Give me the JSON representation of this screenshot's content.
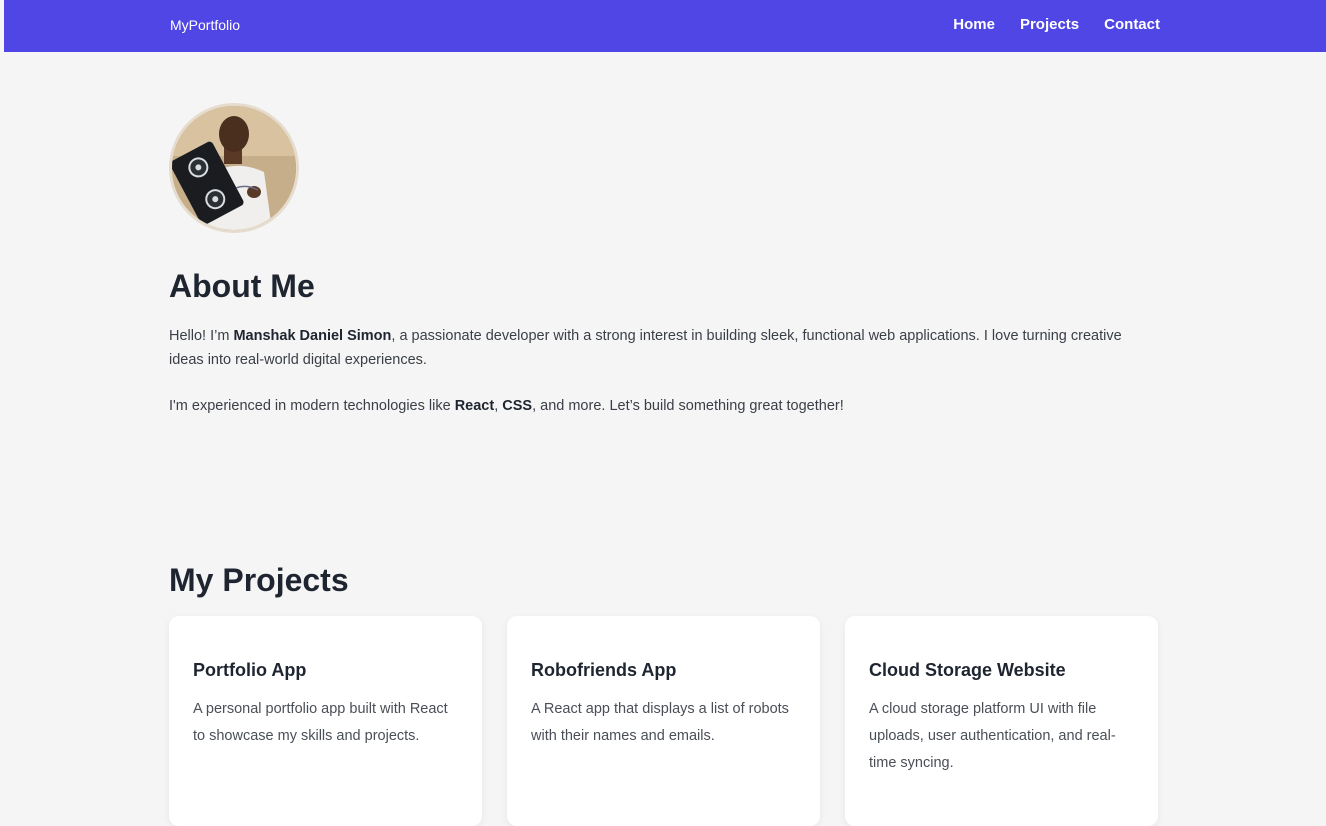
{
  "navbar": {
    "brand": "MyPortfolio",
    "links": [
      {
        "label": "Home"
      },
      {
        "label": "Projects"
      },
      {
        "label": "Contact"
      }
    ]
  },
  "about": {
    "title": "About Me",
    "p1_pre": "Hello! I’m ",
    "p1_name": "Manshak Daniel Simon",
    "p1_post": ", a passionate developer with a strong interest in building sleek, functional web applications. I love turning creative ideas into real-world digital experiences.",
    "p2_pre": "I'm experienced in modern technologies like ",
    "p2_tech1": "React",
    "p2_sep": ", ",
    "p2_tech2": "CSS",
    "p2_post": ", and more. Let’s build something great together!"
  },
  "projects": {
    "title": "My Projects",
    "items": [
      {
        "title": "Portfolio App",
        "description": "A personal portfolio app built with React to showcase my skills and projects."
      },
      {
        "title": "Robofriends App",
        "description": "A React app that displays a list of robots with their names and emails."
      },
      {
        "title": "Cloud Storage Website",
        "description": "A cloud storage platform UI with file uploads, user authentication, and real-time syncing."
      }
    ]
  },
  "colors": {
    "navbar": "#5046e5",
    "background": "#f5f5f5",
    "card": "#ffffff",
    "heading": "#1f2530"
  }
}
